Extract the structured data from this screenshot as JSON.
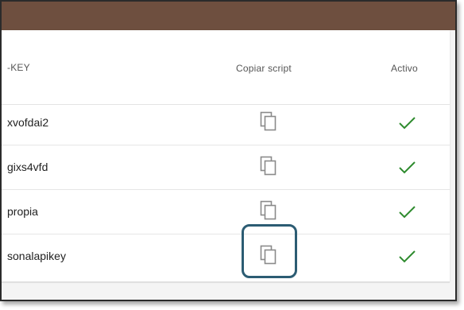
{
  "table": {
    "headers": {
      "key": "-KEY",
      "copy_script": "Copiar script",
      "active": "Activo"
    },
    "rows": [
      {
        "key": "xvofdai2",
        "active_icon": "check-icon"
      },
      {
        "key": "gixs4vfd",
        "active_icon": "check-icon"
      },
      {
        "key": "propia",
        "active_icon": "check-icon"
      },
      {
        "key": "sonalapikey",
        "active_icon": "check-icon"
      }
    ]
  },
  "icons": {
    "copy": "copy-icon",
    "active": "check-icon"
  },
  "colors": {
    "topbar": "#6e4f3f",
    "check": "#2e8b2e",
    "highlight": "#2c5c73",
    "icon_gray": "#8a8a8a"
  }
}
